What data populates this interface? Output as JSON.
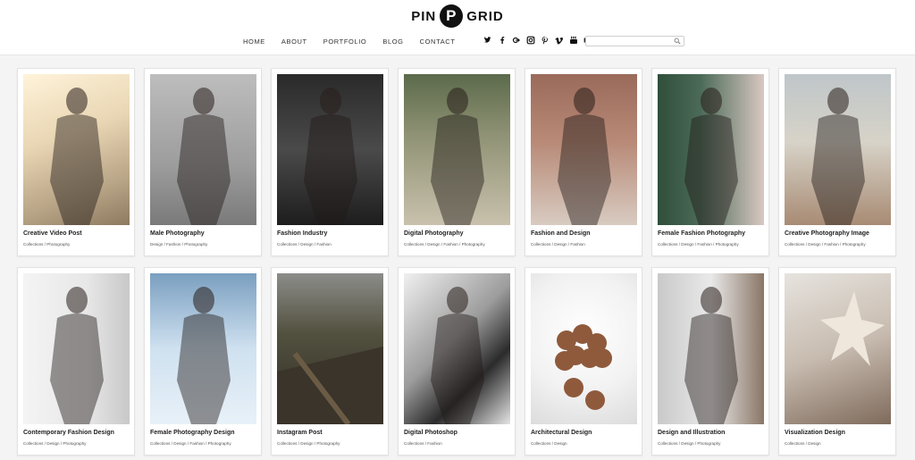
{
  "brand": {
    "left": "PIN",
    "mark": "P",
    "right": "GRID"
  },
  "nav": [
    "HOME",
    "ABOUT",
    "PORTFOLIO",
    "BLOG",
    "CONTACT"
  ],
  "social": [
    "twitter-icon",
    "facebook-icon",
    "google-plus-icon",
    "instagram-icon",
    "pinterest-icon",
    "vimeo-icon",
    "youtube-icon",
    "behance-icon"
  ],
  "search": {
    "placeholder": "",
    "value": ""
  },
  "cards": [
    {
      "title": "Creative Video Post",
      "cats": "Collections / Photography",
      "thumb": "t-sun"
    },
    {
      "title": "Male Photography",
      "cats": "Design / Fashion / Photography",
      "thumb": "t-bw1"
    },
    {
      "title": "Fashion Industry",
      "cats": "Collections / Design / Fashion",
      "thumb": "t-bw2"
    },
    {
      "title": "Digital Photography",
      "cats": "Collections / Design / Fashion / Photography",
      "thumb": "t-hood"
    },
    {
      "title": "Fashion and Design",
      "cats": "Collections / Design / Fashion",
      "thumb": "t-brick"
    },
    {
      "title": "Female Fashion Photography",
      "cats": "Collections / Design / Fashion / Photography",
      "thumb": "t-green"
    },
    {
      "title": "Creative Photography Image",
      "cats": "Collections / Design / Fashion / Photography",
      "thumb": "t-street"
    },
    {
      "title": "Contemporary Fashion Design",
      "cats": "Collections / Design / Photography",
      "thumb": "t-white"
    },
    {
      "title": "Female Photography Design",
      "cats": "Collections / Design / Fashion / Photography",
      "thumb": "t-blue"
    },
    {
      "title": "Instagram Post",
      "cats": "Collections / Design / Photography",
      "thumb": "t-forest"
    },
    {
      "title": "Digital Photoshop",
      "cats": "Collections / Fashion",
      "thumb": "t-mono"
    },
    {
      "title": "Architectural Design",
      "cats": "Collections / Design",
      "thumb": "t-lychee"
    },
    {
      "title": "Design and Illustration",
      "cats": "Collections / Design / Photography",
      "thumb": "t-grey"
    },
    {
      "title": "Visualization Design",
      "cats": "Collections / Design",
      "thumb": "t-star"
    }
  ]
}
